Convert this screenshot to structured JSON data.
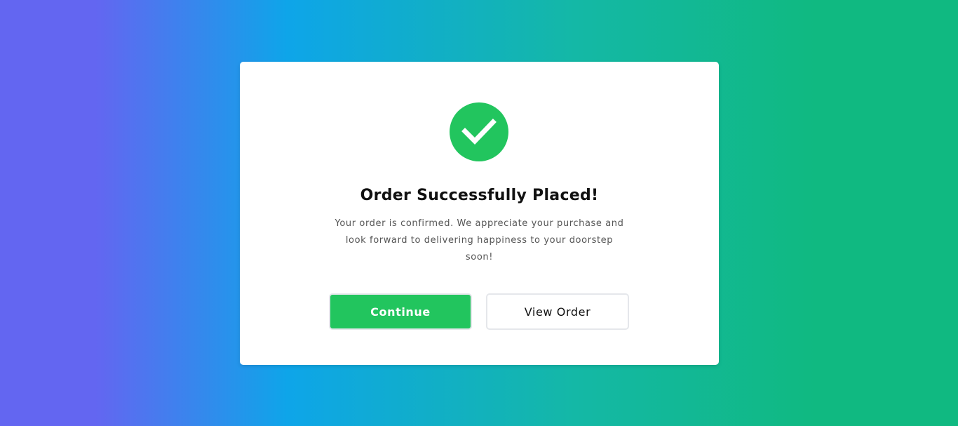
{
  "modal": {
    "title": "Order Successfully Placed!",
    "message": "Your order is confirmed. We appreciate your purchase and look forward to delivering happiness to your doorstep soon!",
    "status_icon": "check-circle-icon",
    "buttons": {
      "continue_label": "Continue",
      "view_order_label": "View Order"
    }
  },
  "colors": {
    "success": "#22c55e",
    "background_gradient": [
      "#6366f1",
      "#0ea5e9",
      "#10b981"
    ]
  }
}
